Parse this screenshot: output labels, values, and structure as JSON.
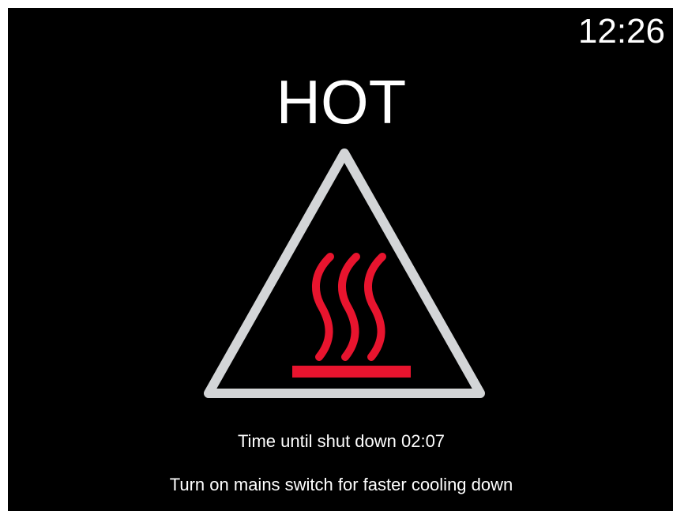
{
  "screen": {
    "clock": "12:26",
    "title": "HOT",
    "icon": "hot-surface-warning-icon",
    "shutdown_message": "Time until shut down 02:07",
    "hint_message": "Turn on mains switch for faster cooling down"
  },
  "colors": {
    "background": "#000000",
    "text": "#ffffff",
    "triangle_stroke": "#d3d5d7",
    "heat_symbol": "#e8142e"
  }
}
